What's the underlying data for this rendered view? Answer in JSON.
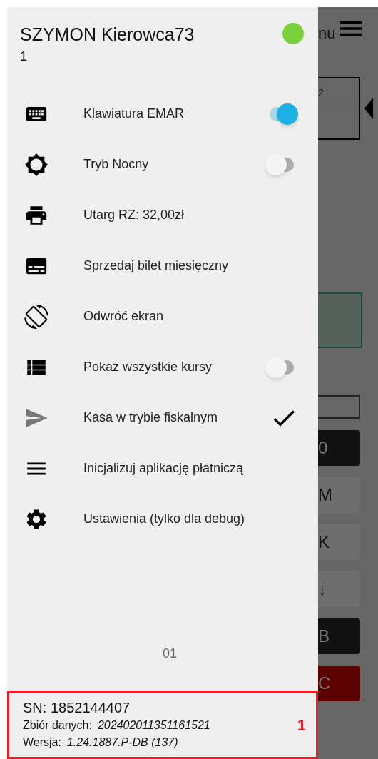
{
  "drawer": {
    "user_name": "SZYMON Kierowca73",
    "user_number": "1",
    "online": true,
    "items": [
      {
        "label": "Klawiatura EMAR",
        "kind": "toggle",
        "on": true
      },
      {
        "label": "Tryb Nocny",
        "kind": "toggle",
        "on": false
      },
      {
        "label": "Utarg RZ: 32,00zł",
        "kind": "plain"
      },
      {
        "label": "Sprzedaj bilet miesięczny",
        "kind": "plain"
      },
      {
        "label": "Odwróć ekran",
        "kind": "plain"
      },
      {
        "label": "Pokaż wszystkie kursy",
        "kind": "toggle",
        "on": false
      },
      {
        "label": "Kasa w trybie fiskalnym",
        "kind": "check",
        "checked": true
      },
      {
        "label": "Inicjalizuj aplikację płatniczą",
        "kind": "plain"
      },
      {
        "label": "Ustawienia (tylko dla debug)",
        "kind": "plain"
      }
    ],
    "code": "01",
    "footer": {
      "sn": "SN: 1852144407",
      "data_label": "Zbiór danych:",
      "data_value": "202402011351161521",
      "version_label": "Wersja:",
      "version_value": "1.24.1887.P-DB (137)",
      "badge": "1"
    }
  },
  "background": {
    "menu_label": "nu",
    "box_text": "2",
    "keys": [
      {
        "label": "0",
        "kind": "dark"
      },
      {
        "label": "M",
        "kind": "light"
      },
      {
        "label": "K",
        "kind": "light"
      },
      {
        "label": "↓",
        "kind": "light"
      },
      {
        "label": "B",
        "kind": "dark"
      },
      {
        "label": "C",
        "kind": "red"
      }
    ]
  }
}
